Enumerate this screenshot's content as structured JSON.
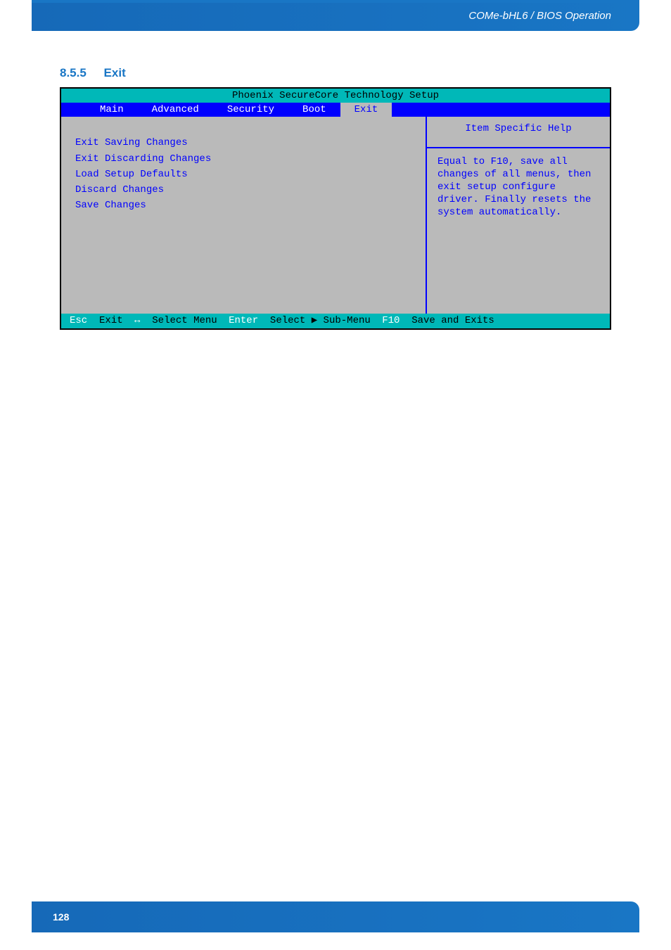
{
  "header": {
    "breadcrumb": "COMe-bHL6 / BIOS Operation"
  },
  "section": {
    "number": "8.5.5",
    "title": "Exit"
  },
  "bios": {
    "title": "Phoenix SecureCore Technology Setup",
    "tabs": [
      {
        "label": "Main",
        "active": false
      },
      {
        "label": "Advanced",
        "active": false
      },
      {
        "label": "Security",
        "active": false
      },
      {
        "label": "Boot",
        "active": false
      },
      {
        "label": "Exit",
        "active": true
      }
    ],
    "menuItems": [
      "Exit Saving Changes",
      "Exit Discarding Changes",
      "Load Setup Defaults",
      "Discard Changes",
      "Save Changes"
    ],
    "help": {
      "title": "Item Specific Help",
      "text": "Equal to F10,  save all changes of all menus, then exit setup configure driver. Finally resets the system automatically."
    },
    "footer": {
      "esc_key": "Esc",
      "esc_label": "Exit",
      "arrows_key": "↔",
      "arrows_label": "Select Menu",
      "enter_key": "Enter",
      "enter_label": "Select ▶ Sub-Menu",
      "f10_key": "F10",
      "f10_label": "Save and Exits"
    }
  },
  "page": {
    "number": "128"
  }
}
